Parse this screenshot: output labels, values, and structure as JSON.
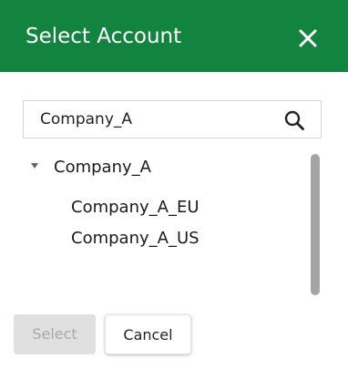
{
  "dialog": {
    "title": "Select Account",
    "close_icon": "close-icon",
    "header_color": "#128440"
  },
  "search": {
    "value": "Company_A",
    "icon": "search-icon"
  },
  "tree": {
    "root": {
      "label": "Company_A",
      "expanded": true,
      "children": [
        {
          "label": "Company_A_EU"
        },
        {
          "label": "Company_A_US"
        }
      ]
    }
  },
  "buttons": {
    "select_label": "Select",
    "select_disabled": true,
    "cancel_label": "Cancel"
  }
}
